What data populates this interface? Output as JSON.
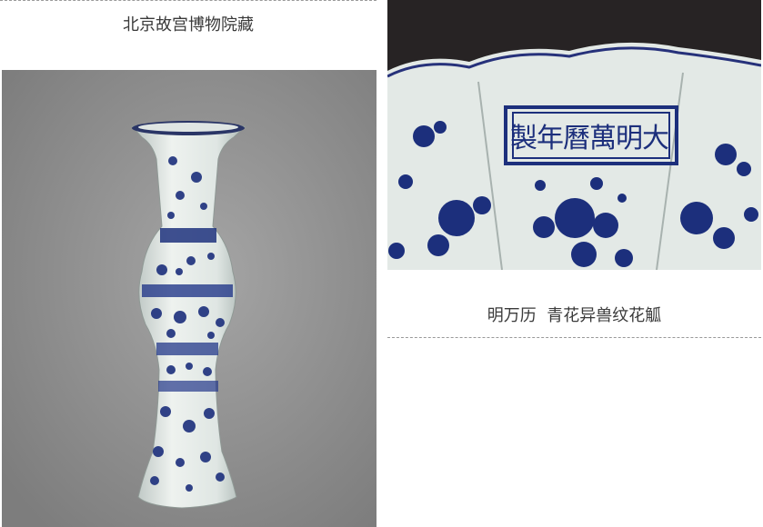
{
  "collection": {
    "caption": "北京故宫博物院藏"
  },
  "artifact": {
    "caption": "明万历  青花异兽纹花觚",
    "reign_mark": [
      "大",
      "明",
      "萬",
      "曆",
      "年",
      "製"
    ]
  },
  "colors": {
    "background": "#ffffff",
    "divider": "#9a9a9a",
    "cobalt": "#1c2f7c",
    "porcelain": "#e6ece8"
  }
}
